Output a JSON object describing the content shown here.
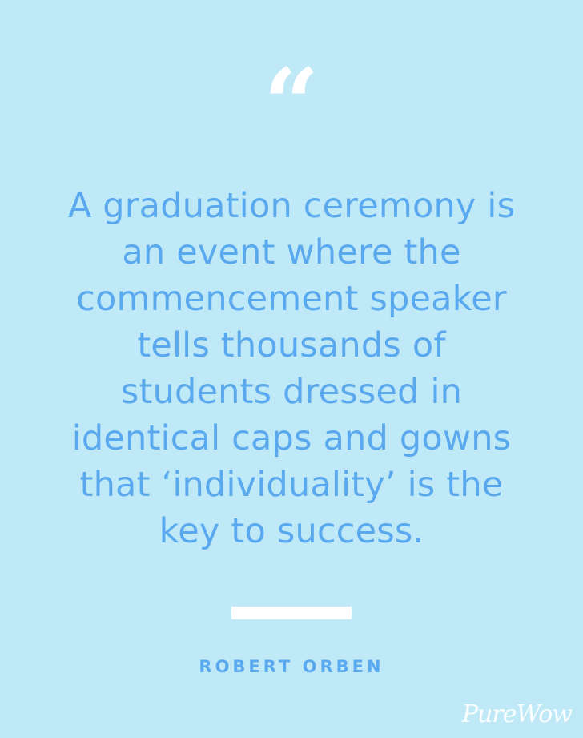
{
  "quote": {
    "mark": "“",
    "lines": [
      "A graduation ceremony is",
      "an event where the",
      "commencement speaker",
      "tells thousands of",
      "students dressed in",
      "identical caps and gowns",
      "that ‘individuality’ is the",
      "key to success."
    ]
  },
  "author": "ROBERT ORBEN",
  "brand": {
    "logo_text": "PureWow"
  },
  "colors": {
    "background": "#bfe9f7",
    "text": "#5aa9ef",
    "accent": "#ffffff"
  }
}
